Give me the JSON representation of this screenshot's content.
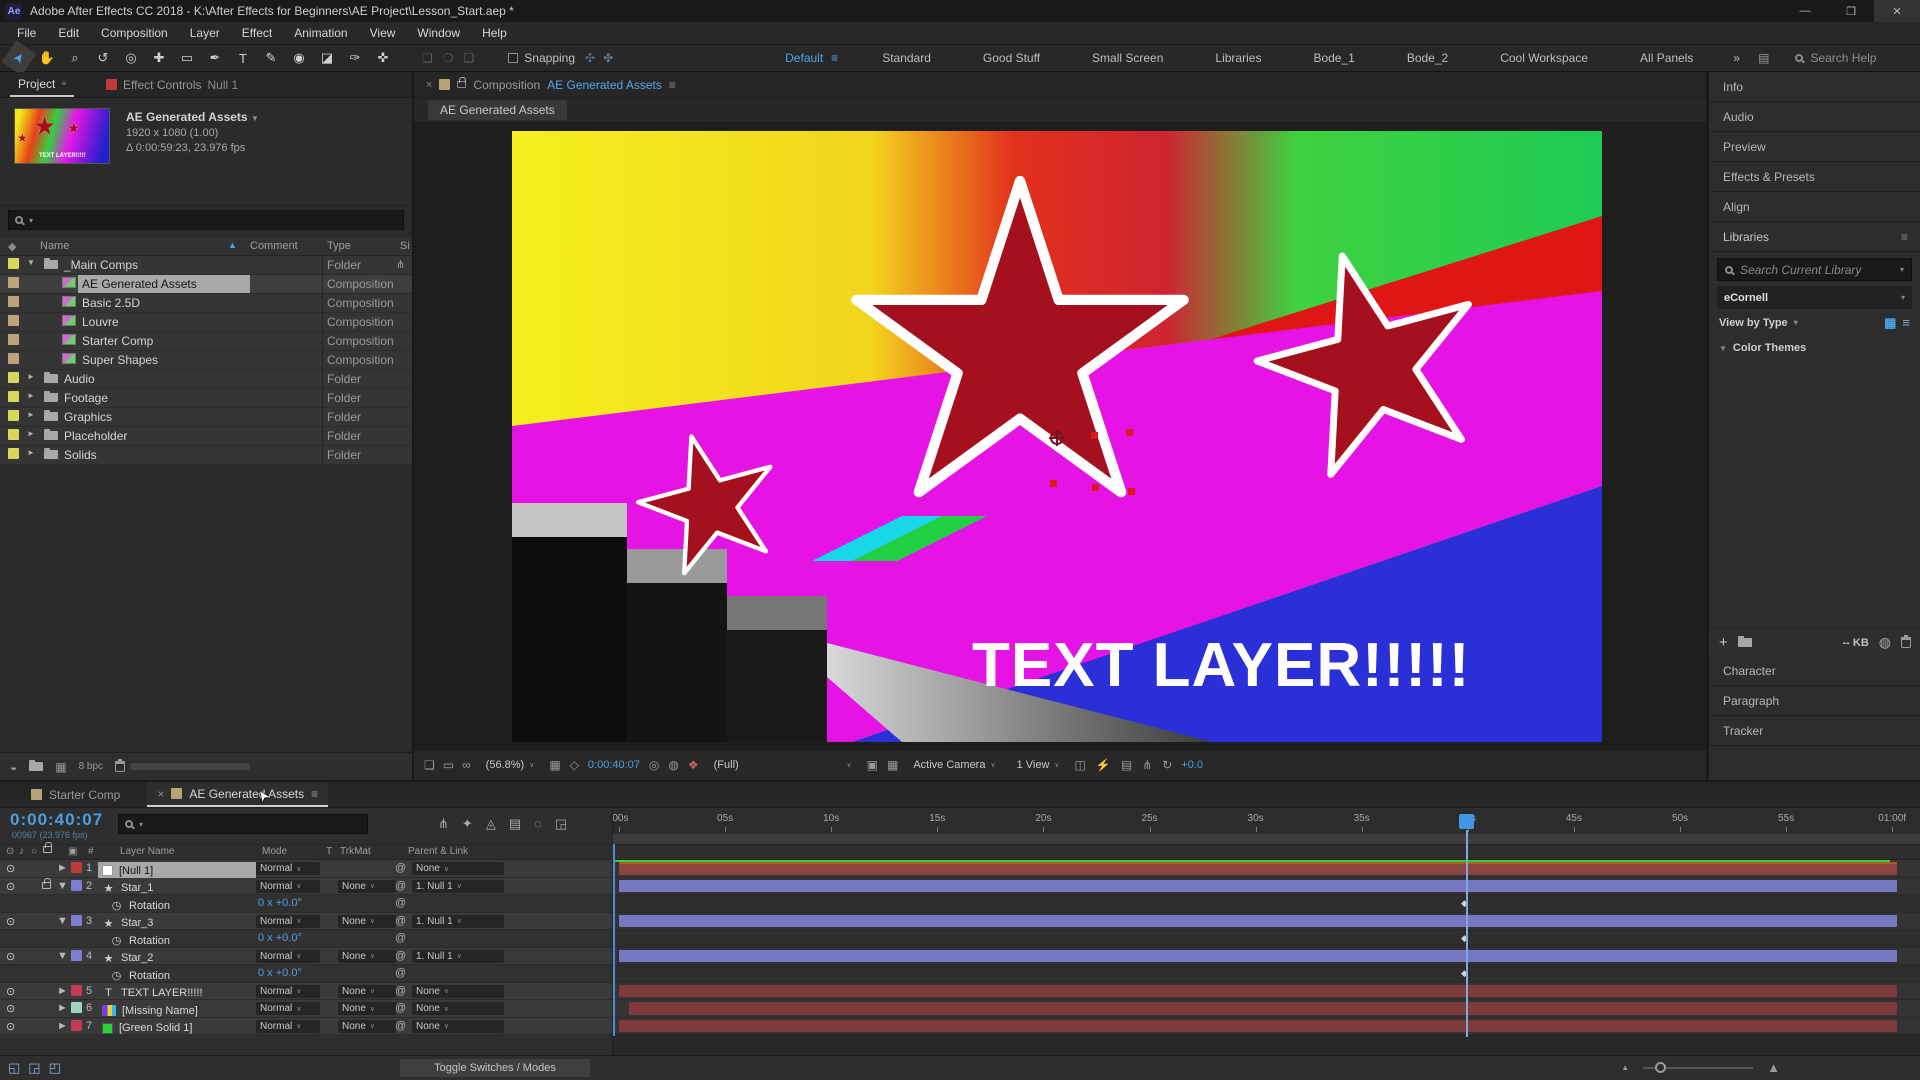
{
  "window": {
    "badge": "Ae",
    "title": "Adobe After Effects CC 2018 - K:\\After Effects for Beginners\\AE Project\\Lesson_Start.aep *",
    "minimize": "—",
    "maximize": "❐",
    "close": "✕"
  },
  "menu": {
    "items": [
      {
        "label": "File"
      },
      {
        "label": "Edit"
      },
      {
        "label": "Composition"
      },
      {
        "label": "Layer"
      },
      {
        "label": "Effect"
      },
      {
        "label": "Animation"
      },
      {
        "label": "View"
      },
      {
        "label": "Window"
      },
      {
        "label": "Help"
      }
    ]
  },
  "toolbar": {
    "tools": [
      {
        "name": "selection-tool",
        "glyph": "➤",
        "cls": "active r45"
      },
      {
        "name": "hand-tool",
        "glyph": "✋",
        "cls": ""
      },
      {
        "name": "zoom-tool",
        "glyph": "⌕",
        "cls": ""
      },
      {
        "name": "rotation-tool",
        "glyph": "↺",
        "cls": ""
      },
      {
        "name": "camera-tool",
        "glyph": "◎",
        "cls": ""
      },
      {
        "name": "pan-behind-tool",
        "glyph": "✚",
        "cls": ""
      },
      {
        "name": "shape-tool",
        "glyph": "▭",
        "cls": ""
      },
      {
        "name": "pen-tool",
        "glyph": "✒",
        "cls": ""
      },
      {
        "name": "type-tool",
        "glyph": "T",
        "cls": ""
      },
      {
        "name": "brush-tool",
        "glyph": "✎",
        "cls": ""
      },
      {
        "name": "clone-stamp-tool",
        "glyph": "◉",
        "cls": ""
      },
      {
        "name": "eraser-tool",
        "glyph": "◪",
        "cls": ""
      },
      {
        "name": "roto-brush-tool",
        "glyph": "✑",
        "cls": ""
      },
      {
        "name": "puppet-pin-tool",
        "glyph": "✜",
        "cls": ""
      }
    ],
    "extra_icons": [
      {
        "glyph": "❏"
      },
      {
        "glyph": "❍"
      },
      {
        "glyph": "❑"
      }
    ],
    "snapping_label": "Snapping",
    "snap_icons": [
      {
        "glyph": "✣"
      },
      {
        "glyph": "✤"
      }
    ],
    "workspaces": [
      {
        "label": "Default",
        "cls": "on",
        "menu": "≡"
      },
      {
        "label": "Standard",
        "cls": "",
        "menu": ""
      },
      {
        "label": "Good Stuff",
        "cls": "",
        "menu": ""
      },
      {
        "label": "Small Screen",
        "cls": "",
        "menu": ""
      },
      {
        "label": "Libraries",
        "cls": "",
        "menu": ""
      },
      {
        "label": "Bode_1",
        "cls": "",
        "menu": ""
      },
      {
        "label": "Bode_2",
        "cls": "",
        "menu": ""
      },
      {
        "label": "Cool Workspace",
        "cls": "",
        "menu": ""
      },
      {
        "label": "All Panels",
        "cls": "",
        "menu": ""
      }
    ],
    "overflow": "»",
    "panel_button": "▤",
    "help_search": "Search Help"
  },
  "project": {
    "tab": "Project",
    "tab_menu": "≡",
    "effect_controls_tab": "Effect Controls",
    "effect_controls_layer": "Null 1",
    "effect_controls_swatch": "#c23a3a",
    "preview": {
      "name": "AE Generated Assets",
      "dropdown": "▼",
      "dims": "1920 x 1080 (1.00)",
      "duration": "Δ 0:00:59:23, 23.976 fps"
    },
    "columns": {
      "tag": "◆",
      "name": "Name",
      "sort": "▲",
      "comment": "Comment",
      "type": "Type",
      "size": "Si"
    },
    "rows": [
      {
        "cls": "",
        "arrow": "▼",
        "label": "#d7d75b",
        "ico": "fold",
        "ind": "",
        "name": "_Main Comps",
        "type": "Folder",
        "extra": "⋔"
      },
      {
        "cls": "sel",
        "arrow": "",
        "label": "#bfa37a",
        "ico": "ico-comp",
        "ind": "ind",
        "name": "AE Generated Assets",
        "type": "Composition",
        "extra": ""
      },
      {
        "cls": "",
        "arrow": "",
        "label": "#bfa37a",
        "ico": "ico-comp",
        "ind": "ind",
        "name": "Basic 2.5D",
        "type": "Composition",
        "extra": ""
      },
      {
        "cls": "",
        "arrow": "",
        "label": "#bfa37a",
        "ico": "ico-comp",
        "ind": "ind",
        "name": "Louvre",
        "type": "Composition",
        "extra": ""
      },
      {
        "cls": "",
        "arrow": "",
        "label": "#bfa37a",
        "ico": "ico-comp",
        "ind": "ind",
        "name": "Starter Comp",
        "type": "Composition",
        "extra": ""
      },
      {
        "cls": "",
        "arrow": "",
        "label": "#bfa37a",
        "ico": "ico-comp",
        "ind": "ind",
        "name": "Super Shapes",
        "type": "Composition",
        "extra": ""
      },
      {
        "cls": "",
        "arrow": "►",
        "label": "#d7d75b",
        "ico": "fold",
        "ind": "",
        "name": "Audio",
        "type": "Folder",
        "extra": ""
      },
      {
        "cls": "",
        "arrow": "►",
        "label": "#d7d75b",
        "ico": "fold",
        "ind": "",
        "name": "Footage",
        "type": "Folder",
        "extra": ""
      },
      {
        "cls": "",
        "arrow": "►",
        "label": "#d7d75b",
        "ico": "fold",
        "ind": "",
        "name": "Graphics",
        "type": "Folder",
        "extra": ""
      },
      {
        "cls": "",
        "arrow": "►",
        "label": "#d7d75b",
        "ico": "fold",
        "ind": "",
        "name": "Placeholder",
        "type": "Folder",
        "extra": ""
      },
      {
        "cls": "",
        "arrow": "►",
        "label": "#d7d75b",
        "ico": "fold",
        "ind": "",
        "name": "Solids",
        "type": "Folder",
        "extra": ""
      }
    ],
    "footer": {
      "icon1": "◒",
      "icon2": "▦",
      "bpc": "8 bpc"
    }
  },
  "composition": {
    "tab_close": "×",
    "tab_swatch": "#b8a376",
    "tab_label": "Composition",
    "tab_name": "AE Generated Assets",
    "tab_menu": "≡",
    "subtab": "AE Generated Assets",
    "viewer_text": "TEXT LAYER!!!!!",
    "toolbar": {
      "icons_left": [
        {
          "glyph": "❏"
        },
        {
          "glyph": "▭"
        },
        {
          "glyph": "∞"
        }
      ],
      "zoom": "(56.8%)",
      "grid_icon": "▦",
      "mask_icon": "◇",
      "timecode": "0:00:40:07",
      "snapshot_icon": "◎",
      "last_snapshot_icon": "◍",
      "channels_icon": "❖",
      "resolution": "(Full)",
      "roi_icon": "▣",
      "transparency_icon": "▦",
      "camera": "Active Camera",
      "view_layout": "1 View",
      "icons_right": [
        {
          "glyph": "◫"
        },
        {
          "glyph": "⚡"
        },
        {
          "glyph": "▤"
        },
        {
          "glyph": "⋔"
        },
        {
          "glyph": "↻"
        }
      ],
      "exposure": "+0.0"
    }
  },
  "sidebar": {
    "panels_top": [
      {
        "label": "Info"
      },
      {
        "label": "Audio"
      },
      {
        "label": "Preview"
      },
      {
        "label": "Effects & Presets"
      },
      {
        "label": "Align"
      }
    ],
    "libraries": {
      "title": "Libraries",
      "menu": "≡",
      "search_placeholder": "Search Current Library",
      "library_name": "eCornell",
      "view_by": "View by Type",
      "grid_icon": "▦",
      "list_icon": "≡",
      "section": "Color Themes",
      "themes": [
        [
          "#a60f27",
          "#d41a38",
          "#ccd1d8",
          "#eef0f7",
          "#f5eef0"
        ],
        [
          "#3f4554",
          "#686b72",
          "#7c0a1e",
          "#9c0d26",
          "#d01233"
        ],
        [
          "#9db5c8",
          "#c6d2e8",
          "#7687b4",
          "#ecb963",
          "#b2ead9"
        ],
        [
          "#c3f1e6",
          "#263340",
          "#f1f1f8",
          "#f7e6ea",
          "#b00a2a"
        ]
      ],
      "add": "+",
      "size_label": "-- KB",
      "cc_icon": "◍"
    },
    "panels_bottom": [
      {
        "label": "Character"
      },
      {
        "label": "Paragraph"
      },
      {
        "label": "Tracker"
      }
    ]
  },
  "timeline": {
    "tabs": [
      {
        "cls": "",
        "close": "",
        "swatch": "#b8a376",
        "name": "Starter Comp",
        "menu": ""
      },
      {
        "cls": "on",
        "close": "×",
        "swatch": "#b8a376",
        "name": "AE Generated Assets",
        "menu": "≡"
      }
    ],
    "timecode": "0:00:40:07",
    "frame_info": "00967 (23.976 fps)",
    "toolbar_icons": [
      {
        "name": "comp-mini-flowchart-icon",
        "glyph": "⋔"
      },
      {
        "name": "draft-3d-icon",
        "glyph": "✦"
      },
      {
        "name": "shy-layers-icon",
        "glyph": "◬"
      },
      {
        "name": "frame-blending-icon",
        "glyph": "▤"
      },
      {
        "name": "motion-blur-icon",
        "glyph": "◌"
      },
      {
        "name": "graph-editor-icon",
        "glyph": "◲"
      }
    ],
    "columns": {
      "eye": "⊙",
      "audio": "♪",
      "solo": "○",
      "label": "▣",
      "num": "#",
      "layer_name": "Layer Name",
      "mode": "Mode",
      "t": "T",
      "trkmat": "TrkMat",
      "parent": "Parent & Link"
    },
    "rows": [
      {
        "cls": "lay sel",
        "eye": "⊙",
        "lock": "",
        "arrow": "►",
        "label": "#c03a3a",
        "num": "1",
        "ico": "ico-null",
        "icg": "",
        "name": "[Null 1]",
        "mode": "Normal",
        "mchev": "∨",
        "trk": "",
        "tchev": "",
        "whip": "@",
        "parent": "None",
        "pchev": "∨",
        "val": "",
        "key": "",
        "bar": "#8a4540",
        "barcls": "bar1",
        "lanecls": ""
      },
      {
        "cls": "lay",
        "eye": "⊙",
        "lock": "mini-lock",
        "arrow": "▼",
        "label": "#7c7cd0",
        "num": "2",
        "ico": "ico-star",
        "icg": "★",
        "name": "Star_1",
        "mode": "Normal",
        "mchev": "∨",
        "trk": "None",
        "tchev": "∨",
        "whip": "@",
        "parent": "1. Null 1",
        "pchev": "∨",
        "val": "",
        "key": "",
        "bar": "#7679c2",
        "barcls": "",
        "lanecls": ""
      },
      {
        "cls": "prp",
        "eye": "",
        "lock": "",
        "arrow": "",
        "label": "",
        "num": "",
        "ico": "ico-watch",
        "icg": "◷",
        "name": "Rotation",
        "mode": "",
        "mchev": "",
        "trk": "",
        "tchev": "",
        "whip": "@",
        "parent": "",
        "pchev": "",
        "val": "0 x +0.0°",
        "key": "◆",
        "bar": "",
        "barcls": "",
        "lanecls": ""
      },
      {
        "cls": "lay",
        "eye": "⊙",
        "lock": "",
        "arrow": "▼",
        "label": "#7c7cd0",
        "num": "3",
        "ico": "ico-star",
        "icg": "★",
        "name": "Star_3",
        "mode": "Normal",
        "mchev": "∨",
        "trk": "None",
        "tchev": "∨",
        "whip": "@",
        "parent": "1. Null 1",
        "pchev": "∨",
        "val": "",
        "key": "",
        "bar": "#7679c2",
        "barcls": "",
        "lanecls": ""
      },
      {
        "cls": "prp",
        "eye": "",
        "lock": "",
        "arrow": "",
        "label": "",
        "num": "",
        "ico": "ico-watch",
        "icg": "◷",
        "name": "Rotation",
        "mode": "",
        "mchev": "",
        "trk": "",
        "tchev": "",
        "whip": "@",
        "parent": "",
        "pchev": "",
        "val": "0 x +0.0°",
        "key": "◆",
        "bar": "",
        "barcls": "",
        "lanecls": ""
      },
      {
        "cls": "lay",
        "eye": "⊙",
        "lock": "",
        "arrow": "▼",
        "label": "#7c7cd0",
        "num": "4",
        "ico": "ico-star",
        "icg": "★",
        "name": "Star_2",
        "mode": "Normal",
        "mchev": "∨",
        "trk": "None",
        "tchev": "∨",
        "whip": "@",
        "parent": "1. Null 1",
        "pchev": "∨",
        "val": "",
        "key": "",
        "bar": "#7679c2",
        "barcls": "",
        "lanecls": ""
      },
      {
        "cls": "prp",
        "eye": "",
        "lock": "",
        "arrow": "",
        "label": "",
        "num": "",
        "ico": "ico-watch",
        "icg": "◷",
        "name": "Rotation",
        "mode": "",
        "mchev": "",
        "trk": "",
        "tchev": "",
        "whip": "@",
        "parent": "",
        "pchev": "",
        "val": "0 x +0.0°",
        "key": "◆",
        "bar": "",
        "barcls": "",
        "lanecls": ""
      },
      {
        "cls": "lay",
        "eye": "⊙",
        "lock": "",
        "arrow": "►",
        "label": "#c23a55",
        "num": "5",
        "ico": "ico-T",
        "icg": "T",
        "name": "TEXT LAYER!!!!!",
        "mode": "Normal",
        "mchev": "∨",
        "trk": "None",
        "tchev": "∨",
        "whip": "@",
        "parent": "None",
        "pchev": "∨",
        "val": "",
        "key": "",
        "bar": "#7e3b3d",
        "barcls": "",
        "lanecls": ""
      },
      {
        "cls": "lay",
        "eye": "⊙",
        "lock": "",
        "arrow": "►",
        "label": "#9dd6c0",
        "num": "6",
        "ico": "ico-media",
        "icg": "",
        "name": "[Missing Name]",
        "mode": "Normal",
        "mchev": "∨",
        "trk": "None",
        "tchev": "∨",
        "whip": "@",
        "parent": "None",
        "pchev": "∨",
        "val": "",
        "key": "",
        "bar": "#7e3b3d",
        "barcls": "bar6",
        "lanecls": ""
      },
      {
        "cls": "lay",
        "eye": "⊙",
        "lock": "",
        "arrow": "►",
        "label": "#c23a55",
        "num": "7",
        "ico": "ico-solid",
        "icg": "",
        "name": "[Green Solid 1]",
        "mode": "Normal",
        "mchev": "∨",
        "trk": "None",
        "tchev": "∨",
        "whip": "@",
        "parent": "None",
        "pchev": "∨",
        "val": "",
        "key": "",
        "bar": "#7e3b3d",
        "barcls": "",
        "lanecls": ""
      }
    ],
    "ruler": [
      {
        "t": ":00s"
      },
      {
        "t": "05s"
      },
      {
        "t": "10s"
      },
      {
        "t": "15s"
      },
      {
        "t": "20s"
      },
      {
        "t": "25s"
      },
      {
        "t": "30s"
      },
      {
        "t": "35s"
      },
      {
        "t": "40s"
      },
      {
        "t": "45s"
      },
      {
        "t": "50s"
      },
      {
        "t": "55s"
      },
      {
        "t": "01:00f"
      }
    ],
    "footer": {
      "icons": [
        {
          "glyph": "◱"
        },
        {
          "glyph": "◲"
        },
        {
          "glyph": "◰"
        }
      ],
      "toggle": "Toggle Switches / Modes"
    }
  }
}
